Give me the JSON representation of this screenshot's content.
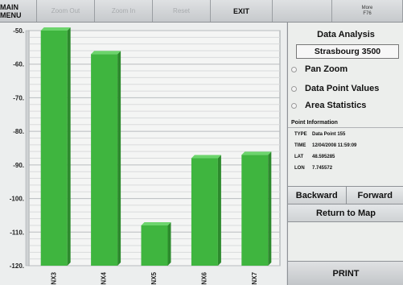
{
  "toolbar": {
    "main_menu": "MAIN MENU",
    "zoom_out": "Zoom Out",
    "zoom_in": "Zoom In",
    "reset": "Reset",
    "exit": "EXIT",
    "more_line1": "More",
    "more_line2": "F76"
  },
  "panel": {
    "title": "Data Analysis",
    "site": "Strasbourg 3500",
    "options": [
      "Pan Zoom",
      "Data Point Values",
      "Area Statistics"
    ],
    "point_info": {
      "heading": "Point Information",
      "rows": [
        {
          "key": "TYPE",
          "value": "Data Point 155"
        },
        {
          "key": "TIME",
          "value": "12/04/2008 11:59:09"
        },
        {
          "key": "LAT",
          "value": "48.595285"
        },
        {
          "key": "LON",
          "value": "7.745572"
        }
      ]
    },
    "backward": "Backward",
    "forward": "Forward",
    "return_to_map": "Return to Map",
    "print": "PRINT"
  },
  "colors": {
    "bar": "#3fb53f",
    "bar_dark": "#2d8a2d",
    "bar_top": "#6cd46c"
  },
  "chart_data": {
    "type": "bar",
    "categories": [
      "NX3",
      "NX4",
      "NX5",
      "NX6",
      "NX7"
    ],
    "values": [
      -50,
      -57,
      -108,
      -88,
      -87
    ],
    "ylim": [
      -120,
      -50
    ],
    "yticks": [
      -50,
      -60,
      -70,
      -80,
      -90,
      -100,
      -110,
      -120
    ],
    "grid": true,
    "baseline": -120
  }
}
